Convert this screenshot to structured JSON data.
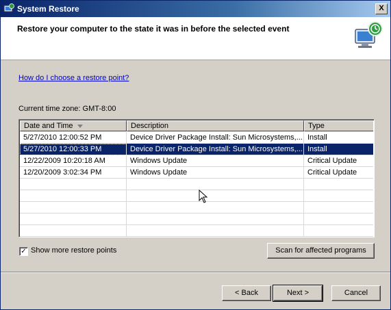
{
  "window": {
    "title": "System Restore",
    "close_label": "X"
  },
  "header": {
    "title": "Restore your computer to the state it was in before the selected event"
  },
  "help_link": "How do I choose a restore point?",
  "timezone": "Current time zone: GMT-8:00",
  "list": {
    "columns": [
      "Date and Time",
      "Description",
      "Type"
    ],
    "sort_column": "Date and Time",
    "rows": [
      {
        "date": "5/27/2010 12:00:52 PM",
        "description": "Device Driver Package Install: Sun Microsystems,...",
        "type": "Install",
        "selected": false
      },
      {
        "date": "5/27/2010 12:00:33 PM",
        "description": "Device Driver Package Install: Sun Microsystems,...",
        "type": "Install",
        "selected": true
      },
      {
        "date": "12/22/2009 10:20:18 AM",
        "description": "Windows Update",
        "type": "Critical Update",
        "selected": false
      },
      {
        "date": "12/20/2009 3:02:34 PM",
        "description": "Windows Update",
        "type": "Critical Update",
        "selected": false
      }
    ]
  },
  "show_more": {
    "label": "Show more restore points",
    "checked": true
  },
  "buttons": {
    "scan": "Scan for affected programs",
    "back": "< Back",
    "next": "Next >",
    "cancel": "Cancel"
  },
  "colors": {
    "selection": "#0a246a",
    "link": "#0000cc",
    "titlebar": "#0a246a"
  }
}
